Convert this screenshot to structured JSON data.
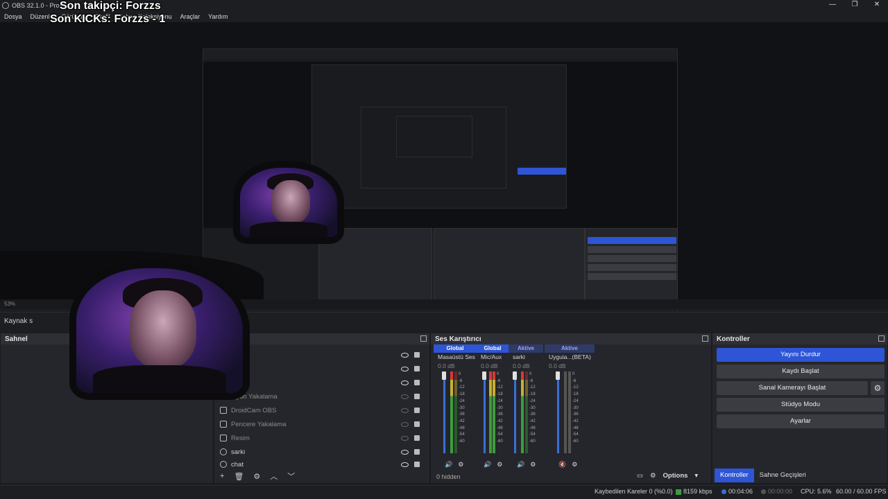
{
  "titlebar": {
    "title": "OBS 32.1.0 - Profil"
  },
  "menu": [
    "Dosya",
    "Düzenle",
    "Görünüm",
    "Profil",
    "Sahne Koleksiyonu",
    "Araçlar",
    "Yardım"
  ],
  "overlay": {
    "follower": "Son takipçi: Forzzs",
    "kicks": "Son KICKs: Forzzs - 1"
  },
  "zoom": {
    "value": "53%"
  },
  "sources_label": "Kaynak s",
  "scenes": {
    "title": "Sahnel"
  },
  "sources": {
    "items": [
      {
        "name": "Oyun Yakalama",
        "visible": false
      },
      {
        "name": "DroidCam OBS",
        "visible": false
      },
      {
        "name": "Pencere Yakalama",
        "visible": false
      },
      {
        "name": "Resim",
        "visible": false
      },
      {
        "name": "sarki",
        "visible": true
      },
      {
        "name": "chat",
        "visible": true
      }
    ]
  },
  "mixer": {
    "title": "Ses Karıştırıcı",
    "channels": [
      {
        "tag": "Global",
        "name": "Masaüstü Ses",
        "db": "0.0 dB",
        "level": 0.9
      },
      {
        "tag": "Global",
        "name": "Mic/Aux",
        "db": "0.0 dB",
        "level": 0.72
      },
      {
        "tag": "Aktive",
        "name": "sarki",
        "db": "0.0 dB",
        "level": 0.85
      },
      {
        "tag": "Aktive",
        "name": "Uyguia...(BETA)",
        "db": "0.0 dB",
        "level": 0.0
      }
    ],
    "scale": [
      "0",
      "-6",
      "-12",
      "-18",
      "-24",
      "-30",
      "-36",
      "-42",
      "-48",
      "-54",
      "-60"
    ],
    "hidden_label": "0 hidden"
  },
  "controls": {
    "title": "Kontroller",
    "buttons": {
      "stop_stream": "Yayını Durdur",
      "start_record": "Kaydı Başlat",
      "start_vcam": "Sanal Kamerayı Başlat",
      "studio_mode": "Stüdyo Modu",
      "settings": "Ayarlar"
    }
  },
  "options_label": "Options",
  "bottom_tabs": [
    "Kontroller",
    "Sahne Geçişleri"
  ],
  "status": {
    "dropped": "Kaybedilen Kareler 0 (%0.0)",
    "bitrate": "8159 kbps",
    "stream_time": "00:04:06",
    "rec_time": "00:00:00",
    "cpu": "CPU: 5.6%",
    "fps": "60.00 / 60.00 FPS"
  },
  "colors": {
    "accent": "#2d55d6",
    "bg": "#1d1e22",
    "panel": "#25262b"
  }
}
